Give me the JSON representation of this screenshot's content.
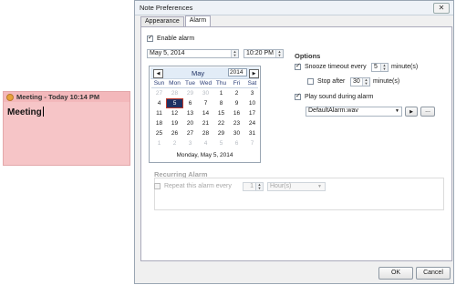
{
  "note": {
    "title": "Meeting - Today 10:14 PM",
    "body": "Meeting"
  },
  "dialog": {
    "title": "Note Preferences",
    "close": "✕",
    "tabs": [
      "Appearance",
      "Alarm"
    ],
    "enable_alarm": "Enable alarm",
    "date": "May 5, 2014",
    "time": "10:20 PM",
    "calendar": {
      "month": "May",
      "year": "2014",
      "prev": "◀",
      "next": "▶",
      "dow": [
        "Sun",
        "Mon",
        "Tue",
        "Wed",
        "Thu",
        "Fri",
        "Sat"
      ],
      "weeks": [
        [
          "27",
          "28",
          "29",
          "30",
          "1",
          "2",
          "3"
        ],
        [
          "4",
          "5",
          "6",
          "7",
          "8",
          "9",
          "10"
        ],
        [
          "11",
          "12",
          "13",
          "14",
          "15",
          "16",
          "17"
        ],
        [
          "18",
          "19",
          "20",
          "21",
          "22",
          "23",
          "24"
        ],
        [
          "25",
          "26",
          "27",
          "28",
          "29",
          "30",
          "31"
        ],
        [
          "1",
          "2",
          "3",
          "4",
          "5",
          "6",
          "7"
        ]
      ],
      "footer": "Monday, May 5, 2014"
    },
    "options": {
      "title": "Options",
      "snooze_label": "Snooze timeout every",
      "snooze_value": "5",
      "snooze_unit": "minute(s)",
      "stop_label": "Stop after",
      "stop_value": "30",
      "stop_unit": "minute(s)",
      "play_label": "Play sound during alarm",
      "sound_file": "DefaultAlarm.wav",
      "play_btn": "▶",
      "browse_btn": "..."
    },
    "recurring": {
      "title": "Recurring Alarm",
      "repeat_label": "Repeat this alarm every",
      "repeat_value": "1",
      "repeat_unit": "Hour(s)"
    },
    "ok": "OK",
    "cancel": "Cancel"
  }
}
